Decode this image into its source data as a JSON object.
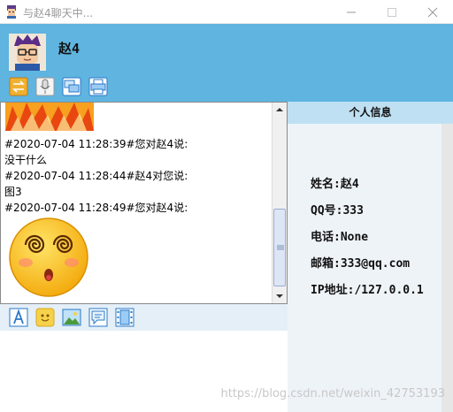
{
  "window": {
    "title": "与赵4聊天中...",
    "controls": [
      "minimize-icon",
      "maximize-icon",
      "close-icon"
    ]
  },
  "header": {
    "contact_name": "赵4",
    "toolbar": [
      "swap-icon",
      "microphone-icon",
      "screen-share-icon",
      "printer-icon"
    ]
  },
  "chat": {
    "messages": [
      {
        "header": "#2020-07-04 11:28:39#您对赵4说:",
        "body": "没干什么"
      },
      {
        "header": "#2020-07-04 11:28:44#赵4对您说:",
        "body": "图3"
      },
      {
        "header": "#2020-07-04 11:28:49#您对赵4说:",
        "body": "dizzy-face-emoji"
      }
    ],
    "partial_image_top": "fire-image"
  },
  "input_toolbar": [
    "font-icon",
    "emoji-icon",
    "image-icon",
    "chat-bubble-icon",
    "film-icon"
  ],
  "info_panel": {
    "title": "个人信息",
    "name": "姓名:赵4",
    "qq": "QQ号:333",
    "phone": "电话:None",
    "email": "邮箱:333@qq.com",
    "ip": "IP地址:/127.0.0.1"
  },
  "watermark": "https://blog.csdn.net/weixin_42753193",
  "colors": {
    "header_bg": "#5fb4e0",
    "info_header_bg": "#bee0f2",
    "input_toolbar_bg": "#e4eff8"
  }
}
